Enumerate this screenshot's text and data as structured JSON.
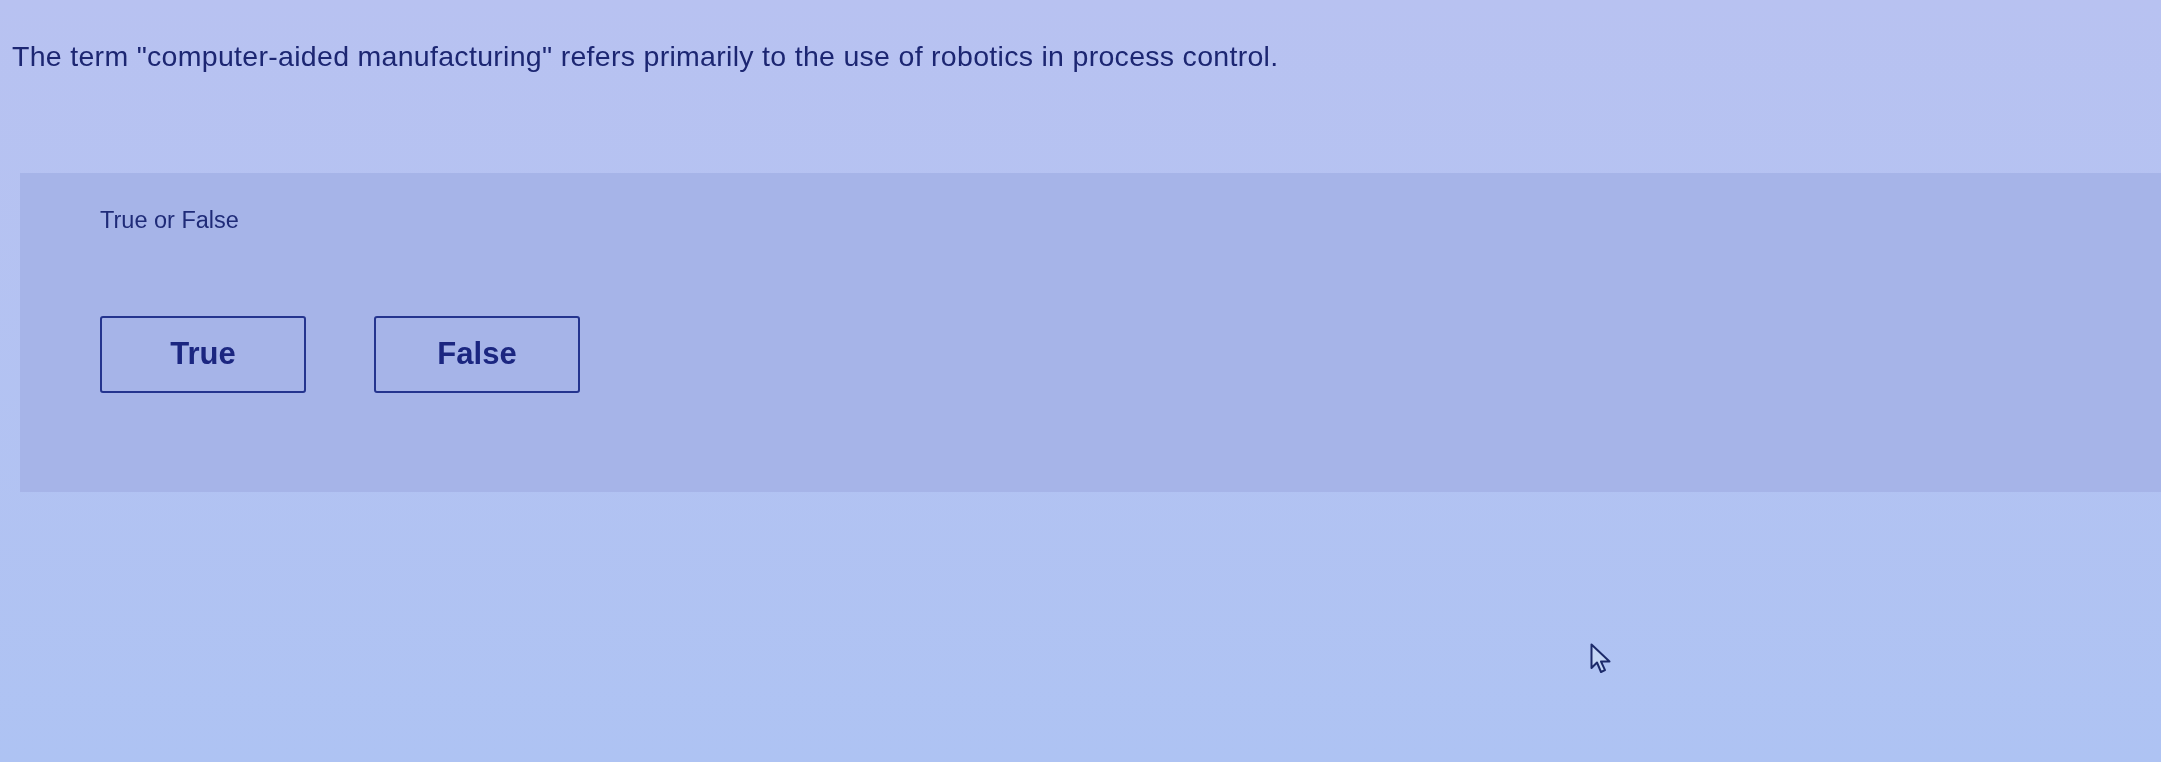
{
  "question": {
    "text": "The term \"computer-aided manufacturing\" refers primarily to the use of robotics in process control."
  },
  "answer_panel": {
    "label": "True or False",
    "options": [
      {
        "label": "True",
        "selected": false
      },
      {
        "label": "False",
        "selected": false
      }
    ]
  }
}
